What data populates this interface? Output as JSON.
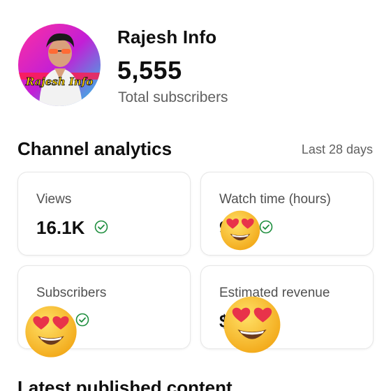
{
  "channel": {
    "name": "Rajesh Info",
    "subscriber_count": "5,555",
    "subscriber_label": "Total subscribers",
    "avatar_text": "Rajesh Info"
  },
  "analytics": {
    "title": "Channel analytics",
    "range": "Last 28 days",
    "cards": [
      {
        "label": "Views",
        "value": "16.1K"
      },
      {
        "label": "Watch time (hours)",
        "value": "9"
      },
      {
        "label": "Subscribers",
        "value": ""
      },
      {
        "label": "Estimated revenue",
        "value": "$"
      }
    ]
  },
  "latest": {
    "title": "Latest published content"
  },
  "colors": {
    "check_green": "#1e8e3e",
    "emoji_yellow": "#f7c12e",
    "heart_red": "#e8334a"
  },
  "icons": {
    "check": "check-circle-icon",
    "emoji": "heart-eyes-emoji-icon"
  }
}
